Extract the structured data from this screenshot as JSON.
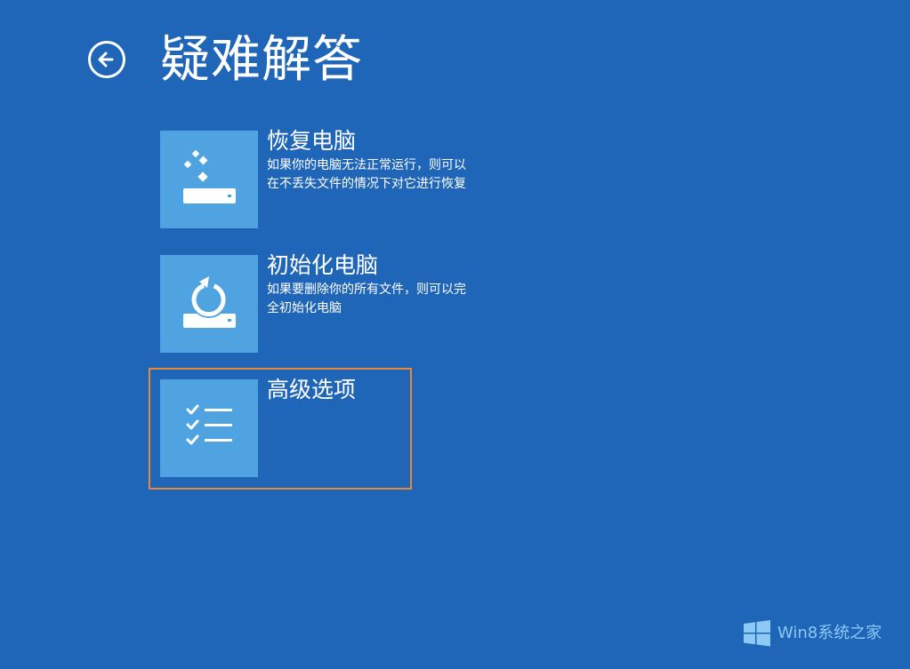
{
  "header": {
    "title": "疑难解答",
    "back_icon": "back-arrow-icon"
  },
  "options": [
    {
      "title": "恢复电脑",
      "desc_lines": [
        "如果你的电脑无法正常运行，则可以",
        "在不丢失文件的情况下对它进行恢复"
      ],
      "icon": "refresh-drive-icon"
    },
    {
      "title": "初始化电脑",
      "desc_lines": [
        "如果要删除你的所有文件，则可以完",
        "全初始化电脑"
      ],
      "icon": "reset-drive-icon"
    },
    {
      "title": "高级选项",
      "desc_lines": [],
      "icon": "checklist-icon",
      "selected": true
    }
  ],
  "watermark": {
    "text": "Win8系统之家",
    "icon": "windows-logo-icon"
  },
  "colors": {
    "background": "#2066b8",
    "tile": "#4fa3e0",
    "selection": "#e8883a",
    "watermark": "#8cc9f5"
  }
}
